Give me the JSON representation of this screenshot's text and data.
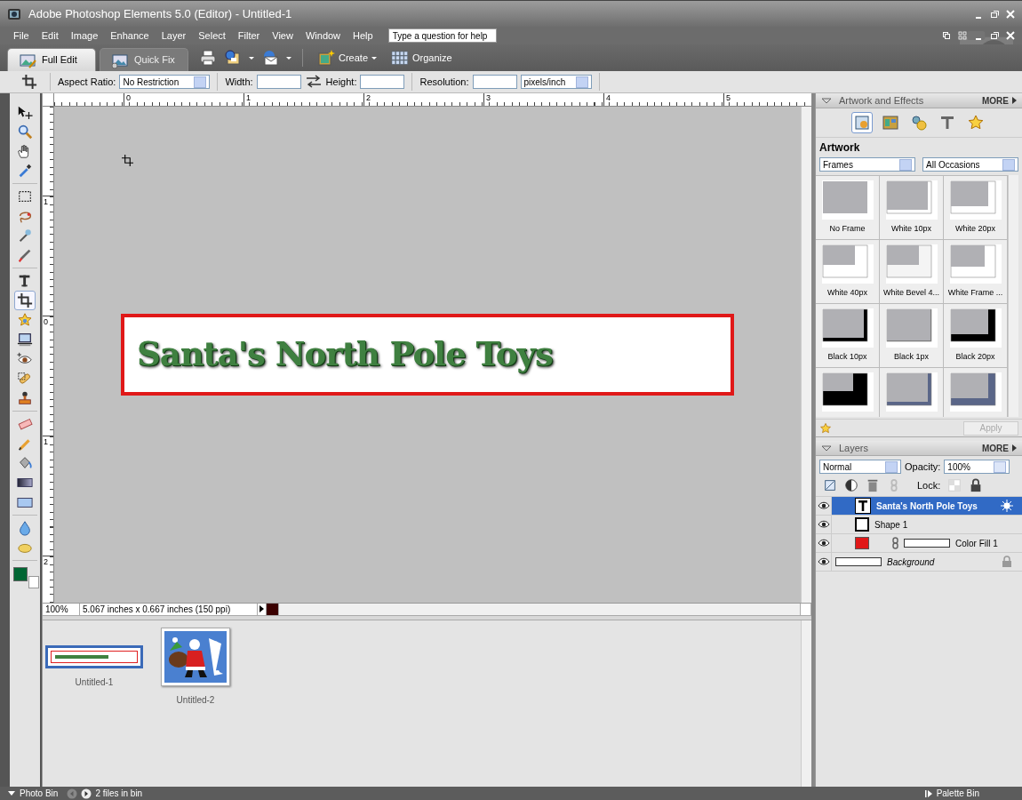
{
  "window": {
    "title": "Adobe Photoshop Elements 5.0 (Editor) - Untitled-1"
  },
  "menu": [
    "File",
    "Edit",
    "Image",
    "Enhance",
    "Layer",
    "Select",
    "Filter",
    "View",
    "Window",
    "Help"
  ],
  "help_field": {
    "placeholder": "Type a question for help"
  },
  "mode_tabs": [
    {
      "label": "Full Edit",
      "selected": true
    },
    {
      "label": "Quick Fix",
      "selected": false
    }
  ],
  "mode_buttons": [
    {
      "label": "Create"
    },
    {
      "label": "Organize"
    }
  ],
  "options": {
    "aspect_ratio_label": "Aspect Ratio:",
    "aspect_ratio": "No Restriction",
    "width_label": "Width:",
    "height_label": "Height:",
    "resolution_label": "Resolution:",
    "resolution_unit": "pixels/inch"
  },
  "tool_groups": [
    {
      "tools": [
        {
          "selected": false
        },
        {
          "selected": false
        },
        {
          "selected": false
        },
        {
          "selected": false
        }
      ]
    },
    {
      "tools": [
        {
          "selected": false
        },
        {
          "selected": false
        },
        {
          "selected": false
        },
        {
          "selected": false
        }
      ]
    },
    {
      "tools": [
        {
          "selected": false
        },
        {
          "selected": true
        },
        {
          "selected": false
        },
        {
          "selected": false
        },
        {
          "selected": false
        },
        {
          "selected": false
        },
        {
          "selected": false
        }
      ]
    },
    {
      "tools": [
        {
          "selected": false
        },
        {
          "selected": false
        },
        {
          "selected": false
        },
        {
          "selected": false
        },
        {
          "selected": false
        }
      ]
    },
    {
      "tools": [
        {
          "selected": false
        },
        {
          "selected": false
        }
      ]
    }
  ],
  "swatches": [
    {
      "color": "#006633"
    },
    {
      "color": "#ffffff"
    }
  ],
  "rulers": {
    "horizontal": [
      "0",
      "1",
      "2",
      "3",
      "4",
      "5"
    ],
    "vertical": [
      "1",
      "0",
      "1",
      "2"
    ]
  },
  "document": {
    "text": "Santa's North Pole Toys"
  },
  "status": {
    "zoom": "100%",
    "info": "5.067 inches x 0.667 inches (150 ppi)"
  },
  "photo_bin": {
    "files": [
      {
        "name": "Untitled-1",
        "kind": "document",
        "selected": true
      },
      {
        "name": "Untitled-2",
        "kind": "picture",
        "selected": false
      }
    ]
  },
  "bottom_bar": {
    "photo_bin": "Photo Bin",
    "count": "2 files in bin",
    "palette_bin": "Palette Bin"
  },
  "artwork_panel": {
    "title": "Artwork and Effects",
    "more": "MORE",
    "categories": [
      {
        "selected": true
      },
      {
        "selected": false
      },
      {
        "selected": false
      },
      {
        "selected": false
      },
      {
        "selected": false
      }
    ],
    "heading": "Artwork",
    "filter": "Frames",
    "occasion": "All Occasions",
    "frames": [
      {
        "label": "No Frame",
        "kind": "plain"
      },
      {
        "label": "White 10px",
        "kind": "white-10"
      },
      {
        "label": "White 20px",
        "kind": "white-20"
      },
      {
        "label": "White 40px",
        "kind": "white-40"
      },
      {
        "label": "White Bevel 4...",
        "kind": "white-bevel"
      },
      {
        "label": "White Frame ...",
        "kind": "white-frame"
      },
      {
        "label": "Black 10px",
        "kind": "black-10"
      },
      {
        "label": "Black 1px",
        "kind": "black-1"
      },
      {
        "label": "Black 20px",
        "kind": "black-20"
      },
      {
        "kind": "black-40"
      },
      {
        "kind": "blue-10"
      },
      {
        "kind": "blue-20"
      }
    ],
    "apply": {
      "label": "Apply",
      "disabled": true
    }
  },
  "layers_panel": {
    "title": "Layers",
    "more": "MORE",
    "blend_mode": "Normal",
    "opacity_label": "Opacity:",
    "opacity": "100%",
    "lock_label": "Lock:",
    "layers": [
      {
        "name": "Santa's North Pole Toys",
        "kind": "text",
        "selected": true,
        "visible": true
      },
      {
        "name": "Shape 1",
        "kind": "shape",
        "selected": false,
        "visible": true
      },
      {
        "name": "Color Fill 1",
        "kind": "fill",
        "selected": false,
        "visible": true
      },
      {
        "name": "Background",
        "kind": "background",
        "selected": false,
        "visible": true
      }
    ]
  }
}
